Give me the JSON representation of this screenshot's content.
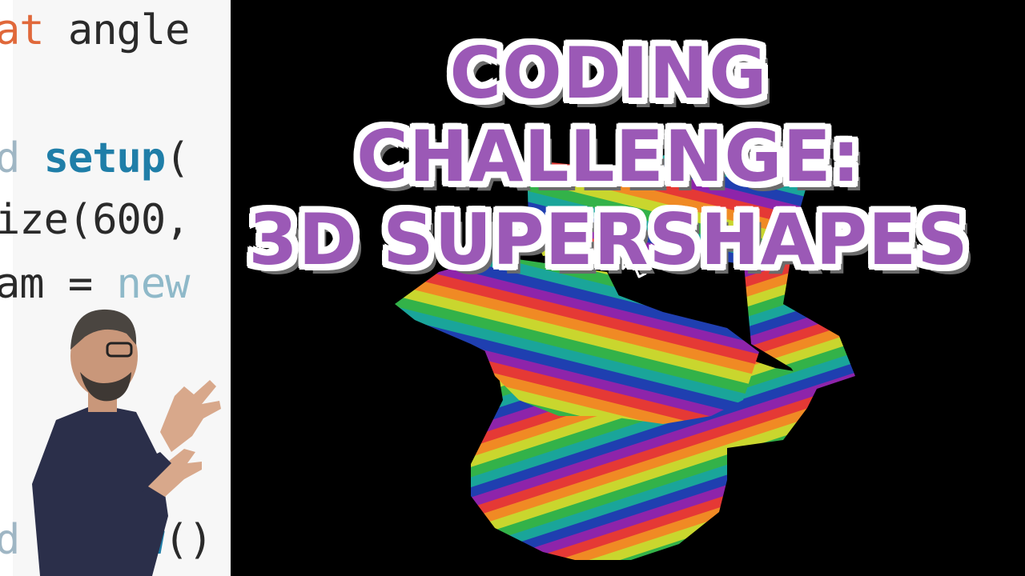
{
  "title": {
    "line1": "CODING CHALLENGE:",
    "line2": "3D SUPERSHAPES"
  },
  "code": {
    "line1_kw": "at",
    "line1_rest": " angle",
    "line2_kw": "d",
    "line2_fn": " setup",
    "line2_rest": "(",
    "line3": "ize(600,",
    "line4_rest": "am = ",
    "line4_kw": "new",
    "line5_kw": "d",
    "line5_fn": "w",
    "line5_rest": "()"
  },
  "colors": {
    "title": "#9b59b6",
    "title_outline": "#ffffff",
    "canvas_bg": "#000000",
    "code_bg": "#f7f7f7"
  },
  "icons": {
    "cursor": "mouse-pointer-icon"
  }
}
